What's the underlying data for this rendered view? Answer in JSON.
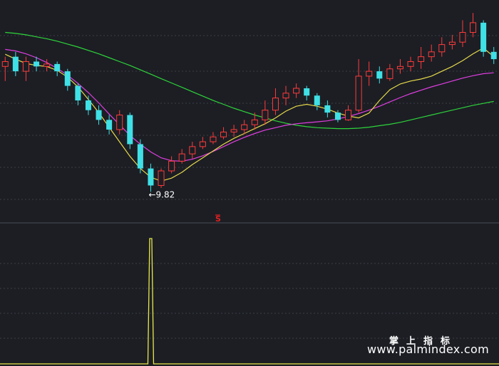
{
  "chart_data": [
    {
      "type": "candlestick",
      "panel": "main",
      "title": "",
      "annotations": {
        "low_label": "←9.82",
        "low_value": 9.82,
        "signal_marker": "S"
      },
      "colors": {
        "up": "#ff3b3b",
        "down": "#3fe0e6",
        "ma_short": "#ffffff",
        "ma_5": "#e6d84a",
        "ma_20": "#e03ee0",
        "ma_60": "#2ed43a"
      },
      "grid": true,
      "ma_series": [
        {
          "name": "",
          "color": "#2ed43a",
          "values": [
            13.1,
            13.08,
            13.05,
            13.01,
            12.97,
            12.92,
            12.86,
            12.8,
            12.73,
            12.66,
            12.58,
            12.5,
            12.42,
            12.33,
            12.24,
            12.15,
            12.06,
            11.97,
            11.88,
            11.79,
            11.7,
            11.62,
            11.54,
            11.47,
            11.4,
            11.34,
            11.28,
            11.23,
            11.19,
            11.16,
            11.14,
            11.13,
            11.12,
            11.12,
            11.13,
            11.15,
            11.18,
            11.21,
            11.25,
            11.3,
            11.35,
            11.4,
            11.45,
            11.5,
            11.55,
            11.6,
            11.64,
            11.68
          ]
        },
        {
          "name": "",
          "color": "#e03ee0",
          "values": [
            12.75,
            12.72,
            12.66,
            12.58,
            12.48,
            12.36,
            12.22,
            12.05,
            11.86,
            11.65,
            11.42,
            11.2,
            10.98,
            10.8,
            10.64,
            10.52,
            10.46,
            10.45,
            10.49,
            10.56,
            10.65,
            10.75,
            10.85,
            10.94,
            11.02,
            11.09,
            11.14,
            11.19,
            11.22,
            11.24,
            11.26,
            11.28,
            11.32,
            11.37,
            11.43,
            11.5,
            11.58,
            11.67,
            11.76,
            11.84,
            11.91,
            11.98,
            12.04,
            12.1,
            12.16,
            12.21,
            12.25,
            12.27
          ]
        },
        {
          "name": "",
          "color": "#e6d84a",
          "values": [
            12.65,
            12.55,
            12.46,
            12.42,
            12.4,
            12.32,
            12.18,
            11.98,
            11.72,
            11.45,
            11.15,
            10.85,
            10.55,
            10.3,
            10.12,
            10.04,
            10.1,
            10.22,
            10.38,
            10.52,
            10.66,
            10.8,
            10.92,
            11.02,
            11.12,
            11.22,
            11.34,
            11.48,
            11.58,
            11.62,
            11.58,
            11.52,
            11.44,
            11.38,
            11.34,
            11.44,
            11.7,
            11.92,
            12.04,
            12.1,
            12.14,
            12.2,
            12.3,
            12.4,
            12.52,
            12.66,
            12.78,
            12.6
          ]
        }
      ],
      "candles": [
        [
          12.4,
          12.5,
          12.1,
          12.6
        ],
        [
          12.6,
          12.3,
          12.2,
          12.7
        ],
        [
          12.3,
          12.5,
          12.1,
          12.6
        ],
        [
          12.5,
          12.4,
          12.3,
          12.6
        ],
        [
          12.4,
          12.45,
          12.3,
          12.55
        ],
        [
          12.45,
          12.3,
          12.2,
          12.5
        ],
        [
          12.3,
          12.0,
          11.9,
          12.35
        ],
        [
          12.0,
          11.7,
          11.6,
          12.05
        ],
        [
          11.7,
          11.5,
          11.4,
          11.8
        ],
        [
          11.5,
          11.3,
          11.2,
          11.6
        ],
        [
          11.3,
          11.1,
          11.0,
          11.4
        ],
        [
          11.1,
          11.4,
          11.0,
          11.5
        ],
        [
          11.4,
          10.8,
          10.7,
          11.45
        ],
        [
          10.8,
          10.3,
          10.2,
          10.9
        ],
        [
          10.3,
          9.95,
          9.82,
          10.4
        ],
        [
          9.95,
          10.25,
          9.9,
          10.3
        ],
        [
          10.25,
          10.45,
          10.2,
          10.55
        ],
        [
          10.45,
          10.6,
          10.4,
          10.7
        ],
        [
          10.6,
          10.75,
          10.5,
          10.85
        ],
        [
          10.75,
          10.85,
          10.7,
          10.95
        ],
        [
          10.85,
          10.95,
          10.8,
          11.05
        ],
        [
          10.95,
          11.05,
          10.9,
          11.15
        ],
        [
          11.05,
          11.1,
          10.95,
          11.2
        ],
        [
          11.1,
          11.2,
          11.0,
          11.3
        ],
        [
          11.2,
          11.3,
          11.1,
          11.45
        ],
        [
          11.3,
          11.5,
          11.2,
          11.7
        ],
        [
          11.5,
          11.75,
          11.4,
          11.95
        ],
        [
          11.75,
          11.85,
          11.6,
          12.0
        ],
        [
          11.85,
          11.95,
          11.75,
          12.05
        ],
        [
          11.95,
          11.8,
          11.7,
          12.0
        ],
        [
          11.8,
          11.6,
          11.5,
          11.85
        ],
        [
          11.6,
          11.45,
          11.35,
          11.7
        ],
        [
          11.45,
          11.3,
          11.25,
          11.5
        ],
        [
          11.3,
          11.5,
          11.28,
          11.6
        ],
        [
          11.5,
          12.2,
          11.45,
          12.55
        ],
        [
          12.2,
          12.3,
          12.0,
          12.5
        ],
        [
          12.3,
          12.15,
          12.05,
          12.4
        ],
        [
          12.15,
          12.35,
          12.1,
          12.45
        ],
        [
          12.35,
          12.4,
          12.25,
          12.55
        ],
        [
          12.4,
          12.5,
          12.3,
          12.6
        ],
        [
          12.5,
          12.6,
          12.35,
          12.8
        ],
        [
          12.6,
          12.7,
          12.5,
          12.85
        ],
        [
          12.7,
          12.85,
          12.6,
          13.0
        ],
        [
          12.85,
          12.9,
          12.75,
          13.05
        ],
        [
          12.9,
          13.1,
          12.8,
          13.35
        ],
        [
          13.1,
          13.3,
          13.0,
          13.5
        ],
        [
          13.3,
          12.7,
          12.6,
          13.35
        ],
        [
          12.7,
          12.55,
          12.45,
          12.8
        ]
      ],
      "ylim": [
        9.4,
        13.65
      ]
    },
    {
      "type": "line",
      "panel": "indicator",
      "title": "",
      "color": "#e8e84a",
      "values": [
        0,
        0,
        0,
        0,
        0,
        0,
        0,
        0,
        0,
        0,
        0,
        0,
        0,
        0,
        1,
        0,
        0,
        0,
        0,
        0,
        0,
        0,
        0,
        0,
        0,
        0,
        0,
        0,
        0,
        0,
        0,
        0,
        0,
        0,
        0,
        0,
        0,
        0,
        0,
        0,
        0,
        0,
        0,
        0,
        0,
        0,
        0,
        0
      ],
      "ylim": [
        0,
        1
      ]
    }
  ],
  "watermark": {
    "cn": "掌上指标",
    "url": "www.palmindex.com"
  }
}
